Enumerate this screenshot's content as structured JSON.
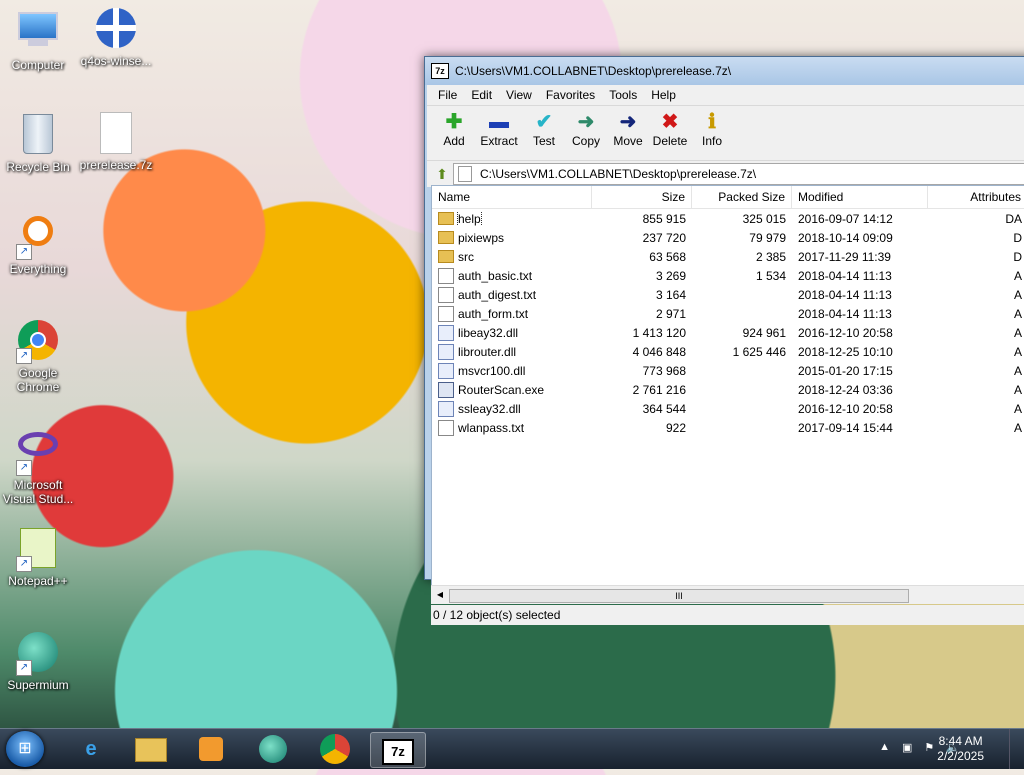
{
  "desktop": {
    "icons": [
      {
        "label": "Computer"
      },
      {
        "label": "q4os-winse..."
      },
      {
        "label": "Recycle Bin"
      },
      {
        "label": "prerelease.7z"
      },
      {
        "label": "Everything"
      },
      {
        "label": "Google Chrome"
      },
      {
        "label": "Microsoft Visual Stud..."
      },
      {
        "label": "Notepad++"
      },
      {
        "label": "Supermium"
      }
    ]
  },
  "window": {
    "app_badge": "7z",
    "title": "C:\\Users\\VM1.COLLABNET\\Desktop\\prerelease.7z\\",
    "menu": [
      "File",
      "Edit",
      "View",
      "Favorites",
      "Tools",
      "Help"
    ],
    "toolbar": [
      {
        "label": "Add",
        "icon": "plus-icon",
        "glyph": "✚",
        "color": "#2aa52a"
      },
      {
        "label": "Extract",
        "icon": "minus-icon",
        "glyph": "▬",
        "color": "#1c3fb5"
      },
      {
        "label": "Test",
        "icon": "test-check-icon",
        "glyph": "✔",
        "color": "#27b4c8"
      },
      {
        "label": "Copy",
        "icon": "copy-arrow-icon",
        "glyph": "➜",
        "color": "#2e8a6a"
      },
      {
        "label": "Move",
        "icon": "move-arrow-icon",
        "glyph": "➜",
        "color": "#14267a"
      },
      {
        "label": "Delete",
        "icon": "delete-x-icon",
        "glyph": "✖",
        "color": "#d01818"
      },
      {
        "label": "Info",
        "icon": "info-icon",
        "glyph": "ℹ",
        "color": "#c89a00"
      }
    ],
    "address": "C:\\Users\\VM1.COLLABNET\\Desktop\\prerelease.7z\\",
    "columns": {
      "name": "Name",
      "size": "Size",
      "packed": "Packed Size",
      "modified": "Modified",
      "attributes": "Attributes"
    },
    "rows": [
      {
        "name": "help",
        "type": "folder",
        "size": "855 915",
        "packed": "325 015",
        "modified": "2016-09-07 14:12",
        "attr": "DA"
      },
      {
        "name": "pixiewps",
        "type": "folder",
        "size": "237 720",
        "packed": "79 979",
        "modified": "2018-10-14 09:09",
        "attr": "D"
      },
      {
        "name": "src",
        "type": "folder",
        "size": "63 568",
        "packed": "2 385",
        "modified": "2017-11-29 11:39",
        "attr": "D"
      },
      {
        "name": "auth_basic.txt",
        "type": "txt",
        "size": "3 269",
        "packed": "1 534",
        "modified": "2018-04-14 11:13",
        "attr": "A"
      },
      {
        "name": "auth_digest.txt",
        "type": "txt",
        "size": "3 164",
        "packed": "",
        "modified": "2018-04-14 11:13",
        "attr": "A"
      },
      {
        "name": "auth_form.txt",
        "type": "txt",
        "size": "2 971",
        "packed": "",
        "modified": "2018-04-14 11:13",
        "attr": "A"
      },
      {
        "name": "libeay32.dll",
        "type": "dll",
        "size": "1 413 120",
        "packed": "924 961",
        "modified": "2016-12-10 20:58",
        "attr": "A"
      },
      {
        "name": "librouter.dll",
        "type": "dll",
        "size": "4 046 848",
        "packed": "1 625 446",
        "modified": "2018-12-25 10:10",
        "attr": "A"
      },
      {
        "name": "msvcr100.dll",
        "type": "dll",
        "size": "773 968",
        "packed": "",
        "modified": "2015-01-20 17:15",
        "attr": "A"
      },
      {
        "name": "RouterScan.exe",
        "type": "exe",
        "size": "2 761 216",
        "packed": "",
        "modified": "2018-12-24 03:36",
        "attr": "A"
      },
      {
        "name": "ssleay32.dll",
        "type": "dll",
        "size": "364 544",
        "packed": "",
        "modified": "2016-12-10 20:58",
        "attr": "A"
      },
      {
        "name": "wlanpass.txt",
        "type": "txt",
        "size": "922",
        "packed": "",
        "modified": "2017-09-14 15:44",
        "attr": "A"
      }
    ],
    "scroll_thumb": "III",
    "status": "0 / 12 object(s) selected"
  },
  "taskbar": {
    "time": "8:44 AM",
    "date": "2/2/2025",
    "active_app": "7z"
  }
}
